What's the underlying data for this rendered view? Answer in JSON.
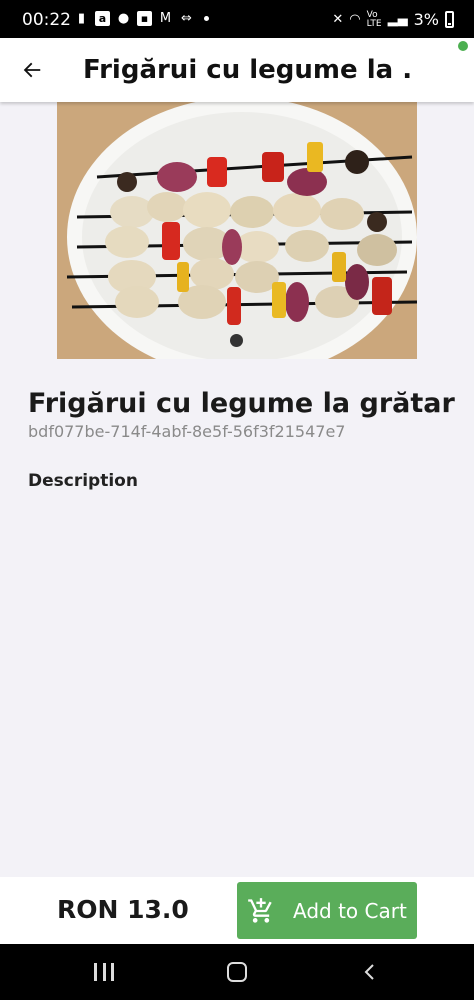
{
  "status_bar": {
    "time": "00:22",
    "battery": "3%",
    "icons": [
      "notification-icon",
      "amazon-icon",
      "account-icon",
      "app-icon",
      "gmail-icon",
      "fitness-icon",
      "mute-icon",
      "wifi-icon",
      "volte-icon",
      "signal-icon",
      "battery-icon"
    ]
  },
  "app_bar": {
    "title": "Frigărui cu legume la ..."
  },
  "product": {
    "title": "Frigărui cu legume la grătar",
    "id": "bdf077be-714f-4abf-8e5f-56f3f21547e7",
    "description_label": "Description",
    "image": "grilled-skewers-photo"
  },
  "carousel": {
    "pages": 1,
    "current": 1
  },
  "bottom_bar": {
    "price": "RON 13.0",
    "add_to_cart_label": "Add to Cart"
  },
  "colors": {
    "accent": "#5aad5a",
    "background": "#f3f2f7",
    "status_dot": "#4caf50"
  }
}
